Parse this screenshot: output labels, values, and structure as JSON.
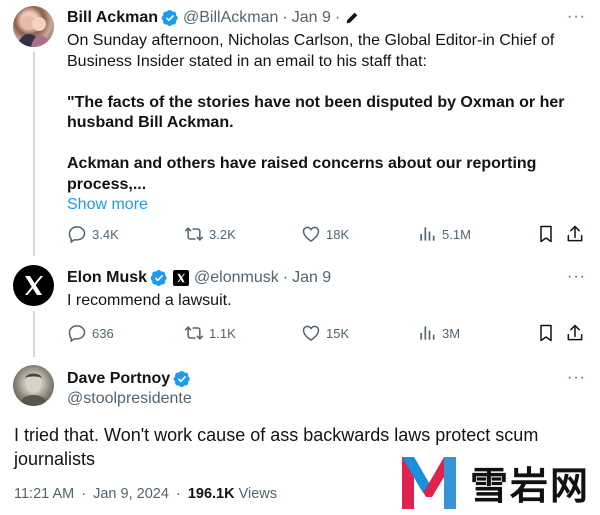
{
  "tweets": [
    {
      "name": "Bill Ackman",
      "handle": "@BillAckman",
      "date": "Jan 9",
      "edited": true,
      "body_lines": [
        "On Sunday afternoon, Nicholas Carlson, the Global Editor-in Chief of",
        "Business Insider stated in an email to his staff that:"
      ],
      "quote_lines": [
        "\"The facts of the stories have not been disputed by Oxman or her",
        "husband Bill Ackman.",
        "Ackman and others have raised concerns about our reporting",
        "process,..."
      ],
      "show_more": "Show more",
      "stats": {
        "replies": "3.4K",
        "reposts": "3.2K",
        "likes": "18K",
        "views": "5.1M"
      }
    },
    {
      "name": "Elon Musk",
      "handle": "@elonmusk",
      "date": "Jan 9",
      "body": "I recommend a lawsuit.",
      "stats": {
        "replies": "636",
        "reposts": "1.1K",
        "likes": "15K",
        "views": "3M"
      }
    },
    {
      "name": "Dave Portnoy",
      "handle": "@stoolpresidente",
      "body_lines": [
        "I tried that.  Won't work cause of ass backwards laws protect scum",
        "journalists"
      ],
      "time": "11:21 AM",
      "full_date": "Jan 9, 2024",
      "views": "196.1K",
      "views_label": "Views"
    }
  ],
  "separator": "·",
  "more_glyph": "···",
  "watermark": {
    "text": "雪岩网"
  },
  "colors": {
    "verified": "#1d9bf0",
    "link": "#1d9bf0",
    "secondary": "#536471",
    "thread_line": "#cfd9de"
  }
}
